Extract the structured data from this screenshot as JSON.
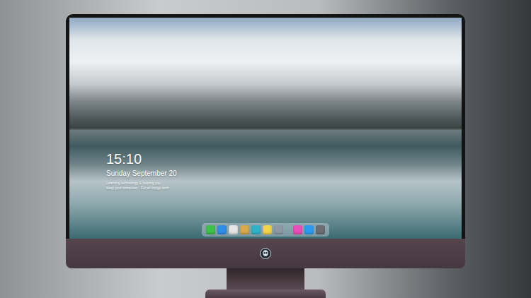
{
  "lock_screen": {
    "time": "15:10",
    "date": "Sunday September 20",
    "notes": [
      "Learning technology & helping you",
      "keep your computer · For all things tech"
    ]
  },
  "dock": {
    "groups": [
      [
        {
          "color": "#3ec24a"
        },
        {
          "color": "#2f8fe8"
        },
        {
          "color": "#e6e6e6"
        },
        {
          "color": "#d9a94a"
        },
        {
          "color": "#2fb3c9"
        },
        {
          "color": "#f3d34a"
        },
        {
          "color": "#8e9aa6"
        }
      ],
      [
        {
          "color": "#e94fb8"
        },
        {
          "color": "#2b9cf2"
        },
        {
          "color": "#6b6f75"
        }
      ]
    ]
  }
}
